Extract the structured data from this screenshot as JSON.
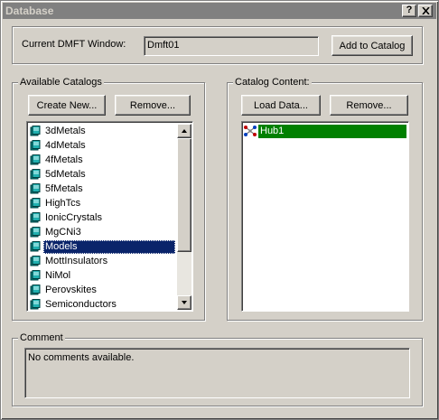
{
  "window": {
    "title": "Database",
    "help_label": "?"
  },
  "top": {
    "label": "Current DMFT Window:",
    "value": "Dmft01",
    "add_button": "Add to Catalog"
  },
  "available": {
    "title": "Available Catalogs",
    "create_button": "Create New...",
    "remove_button": "Remove...",
    "items": [
      "3dMetals",
      "4dMetals",
      "4fMetals",
      "5dMetals",
      "5fMetals",
      "HighTcs",
      "IonicCrystals",
      "MgCNi3",
      "Models",
      "MottInsulators",
      "NiMol",
      "Perovskites",
      "Semiconductors"
    ],
    "selected": "Models",
    "icon": "database-icon"
  },
  "content": {
    "title": "Catalog Content:",
    "load_button": "Load Data...",
    "remove_button": "Remove...",
    "items": [
      "Hub1"
    ],
    "selected": "Hub1",
    "icon": "molecule-icon"
  },
  "comment": {
    "title": "Comment",
    "text": "No comments available."
  },
  "colors": {
    "face": "#d4d0c8",
    "title_inactive": "#808080",
    "selection": "#0a246a",
    "content_selection": "#008000"
  }
}
